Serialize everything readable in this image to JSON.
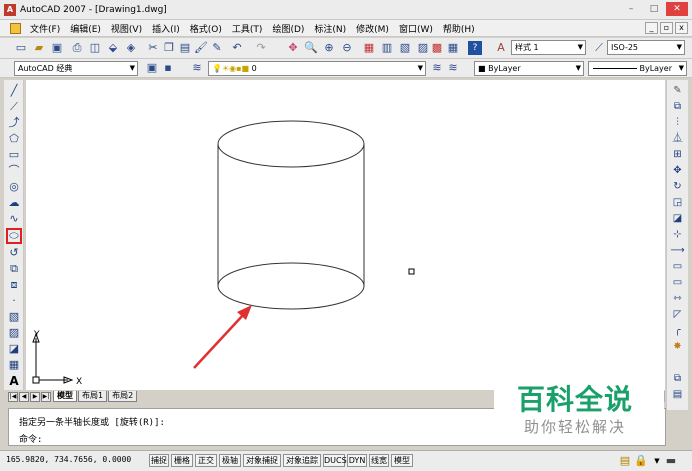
{
  "window": {
    "title": "AutoCAD 2007 - [Drawing1.dwg]",
    "controls": [
      "–",
      "□",
      "✕"
    ]
  },
  "menu": {
    "items": [
      "文件(F)",
      "编辑(E)",
      "视图(V)",
      "插入(I)",
      "格式(O)",
      "工具(T)",
      "绘图(D)",
      "标注(N)",
      "修改(M)",
      "窗口(W)",
      "帮助(H)"
    ],
    "mdi_controls": [
      "_",
      "▫",
      "x"
    ]
  },
  "toolbar": {
    "text_style": "样式 1",
    "dim_style": "ISO-25",
    "workspace": "AutoCAD 经典",
    "layer": "0",
    "color": "ByLayer",
    "linetype": "ByLayer"
  },
  "left_tools": [
    "line-icon",
    "construction-line-icon",
    "polyline-icon",
    "polygon-icon",
    "rectangle-icon",
    "arc-icon",
    "circle-icon",
    "revision-cloud-icon",
    "spline-icon",
    "ellipse-icon",
    "ellipse-arc-icon",
    "insert-block-icon",
    "make-block-icon",
    "point-icon",
    "hatch-icon",
    "gradient-icon",
    "region-icon",
    "table-icon",
    "multiline-text-icon"
  ],
  "right_tools": [
    "erase-icon",
    "copy-icon",
    "mirror-icon",
    "offset-icon",
    "array-icon",
    "move-icon",
    "rotate-icon",
    "scale-icon",
    "stretch-icon",
    "trim-icon",
    "extend-icon",
    "break-at-point-icon",
    "break-icon",
    "join-icon",
    "chamfer-icon",
    "fillet-icon",
    "explode-icon"
  ],
  "tabs": {
    "nav": [
      "|◀",
      "◀",
      "▶",
      "▶|"
    ],
    "items": [
      "模型",
      "布局1",
      "布局2"
    ]
  },
  "ucs": {
    "x": "X",
    "y": "Y"
  },
  "command": {
    "line1": "指定另一条半轴长度或 [旋转(R)]:",
    "line2": "命令:"
  },
  "status": {
    "coords": "165.9820, 734.7656, 0.0000",
    "buttons": [
      "捕捉",
      "栅格",
      "正交",
      "极轴",
      "对象捕捉",
      "对象追踪",
      "DUCS",
      "DYN",
      "线宽",
      "模型"
    ]
  },
  "watermark": {
    "main": "百科全说",
    "sub": "助你轻松解决"
  },
  "colors": {
    "active_tool_highlight": "#e02020",
    "arrow": "#e03030",
    "watermark_green": "#1aa06a"
  }
}
